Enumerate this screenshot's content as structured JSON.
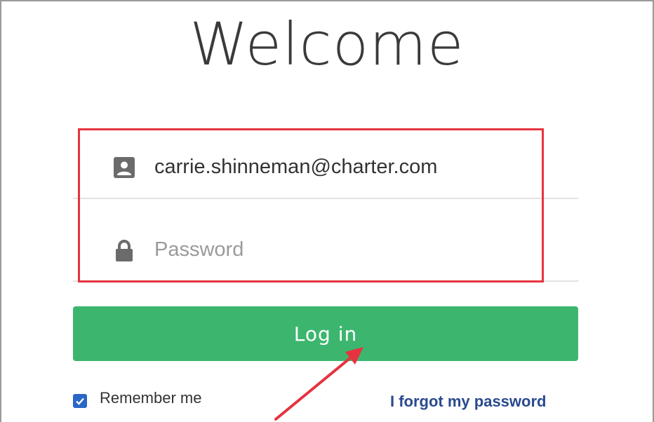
{
  "title": "Welcome",
  "email": {
    "value": "carrie.shinneman@charter.com",
    "icon": "contact-card-icon"
  },
  "password": {
    "placeholder": "Password",
    "value": "",
    "icon": "lock-icon"
  },
  "login_button": {
    "label": "Log in"
  },
  "remember_me": {
    "label": "Remember me",
    "checked": true
  },
  "forgot_password": {
    "label": "I forgot my password"
  },
  "colors": {
    "accent": "#3cb66f",
    "highlight": "#e53340",
    "link": "#2a4a8f",
    "checkbox": "#2a66c6"
  }
}
